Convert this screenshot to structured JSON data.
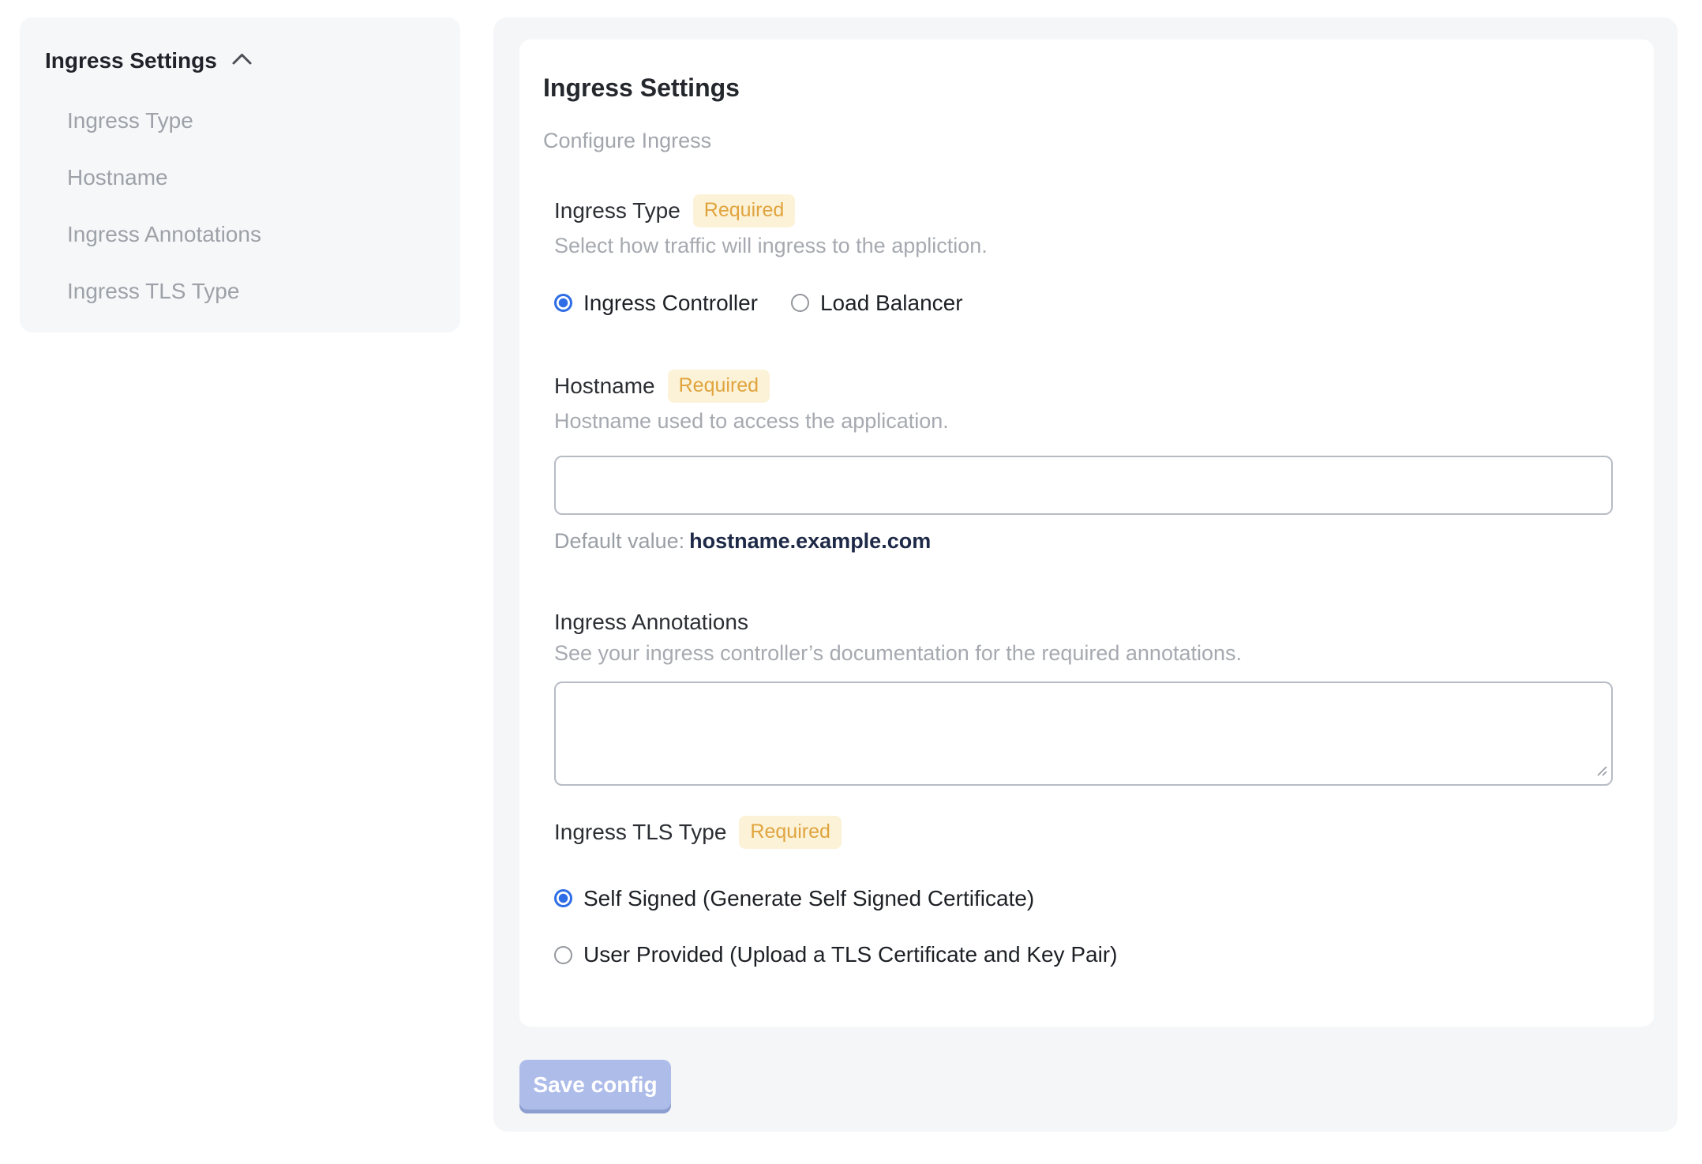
{
  "sidebar": {
    "title": "Ingress Settings",
    "collapse_icon": "chevron-up-icon",
    "items": [
      {
        "label": "Ingress Type"
      },
      {
        "label": "Hostname"
      },
      {
        "label": "Ingress Annotations"
      },
      {
        "label": "Ingress TLS Type"
      }
    ]
  },
  "panel": {
    "title": "Ingress Settings",
    "subtitle": "Configure Ingress",
    "required_badge": "Required",
    "sections": {
      "ingress_type": {
        "label": "Ingress Type",
        "required": true,
        "description": "Select how traffic will ingress to the appliction.",
        "options": [
          {
            "label": "Ingress Controller",
            "selected": true
          },
          {
            "label": "Load Balancer",
            "selected": false
          }
        ]
      },
      "hostname": {
        "label": "Hostname",
        "required": true,
        "description": "Hostname used to access the application.",
        "value": "",
        "default_label": "Default value:",
        "default_value": "hostname.example.com"
      },
      "ingress_annotations": {
        "label": "Ingress Annotations",
        "required": false,
        "description": "See your ingress controller’s documentation for the required annotations.",
        "value": ""
      },
      "ingress_tls_type": {
        "label": "Ingress TLS Type",
        "required": true,
        "options": [
          {
            "label": "Self Signed (Generate Self Signed Certificate)",
            "selected": true
          },
          {
            "label": "User Provided (Upload a TLS Certificate and Key Pair)",
            "selected": false
          }
        ]
      }
    },
    "save_button": "Save config"
  },
  "colors": {
    "accent_blue": "#2e6de6",
    "badge_bg": "#fcf2d7",
    "badge_text": "#e0a43e",
    "panel_bg": "#f5f6f8",
    "sidebar_bg": "#f6f7f9",
    "save_button_bg": "#aebce9",
    "save_button_edge": "#8d9fd0",
    "default_value_text": "#1d2946",
    "muted_text": "#a6aab0"
  }
}
